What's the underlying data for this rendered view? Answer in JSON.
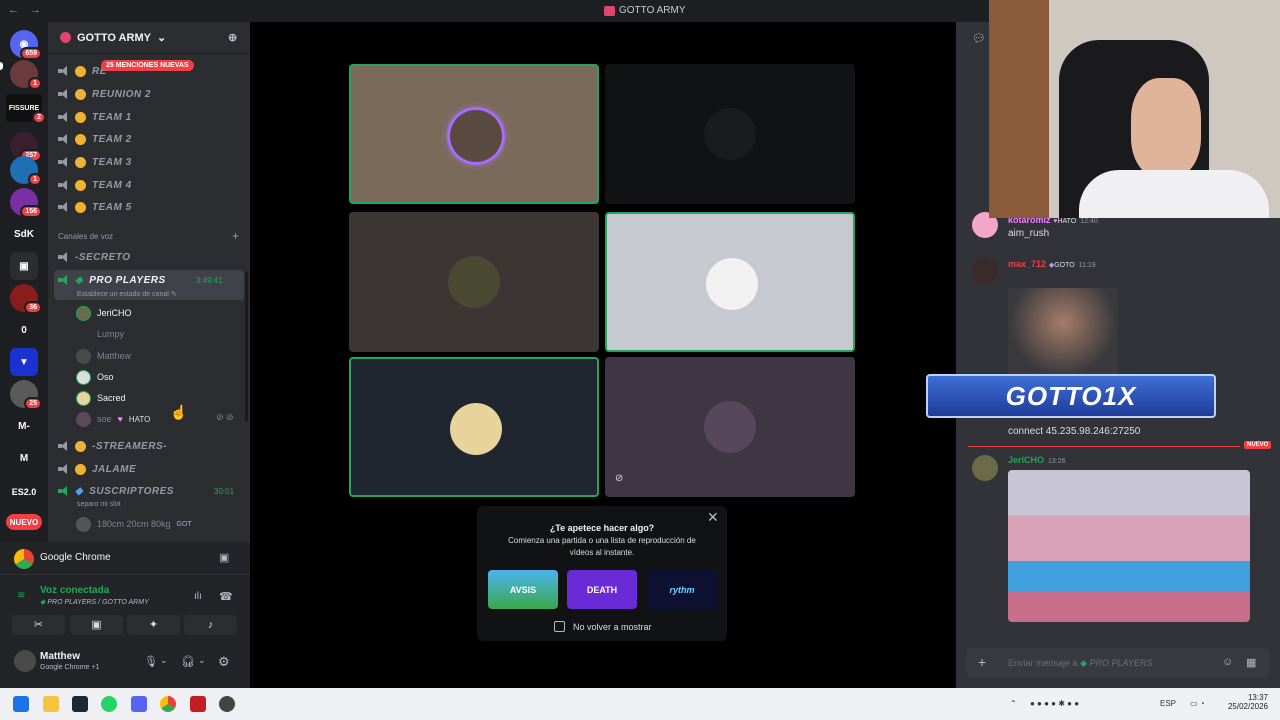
{
  "window": {
    "title": "GOTTO ARMY",
    "nav": "← →"
  },
  "rail": {
    "badges": [
      "659",
      "1",
      "2",
      "257",
      "1",
      "156",
      "36",
      "25"
    ],
    "labels": {
      "fissure": "FISSURE",
      "sdk": "SdK",
      "zero": "0",
      "m_dash": "M-",
      "m": "M",
      "es": "ES2.0",
      "nuevo": "NUEVO"
    }
  },
  "guild": {
    "name": "GOTTO ARMY",
    "mentions": "25 MENCIONES NUEVAS"
  },
  "channels": {
    "top": [
      "REUNION 2",
      "TEAM 1",
      "TEAM 2",
      "TEAM 3",
      "TEAM 4",
      "TEAM 5"
    ],
    "first_partial": "RE",
    "voice_category": "Canales de voz",
    "secreto": "-SECRETO",
    "pro_players": {
      "name": "PRO PLAYERS",
      "time": "3:49:41",
      "status": "Establece un estado de canal"
    },
    "members": [
      "JeriCHO",
      "Lumpy",
      "Matthew",
      "Oso",
      "Sacred",
      "soe"
    ],
    "soe_tag": "HATO",
    "streamers": "-STREAMERS-",
    "jalame": "JALAME",
    "suscriptores": {
      "name": "SUSCRIPTORES",
      "time": "30:01",
      "status": "separo mi slot"
    },
    "sub_member": "180cm 20cm 80kg",
    "sub_tag": "GOT"
  },
  "panel": {
    "app": "Google Chrome",
    "voice_status": "Voz conectada",
    "voice_channel": "PRO PLAYERS / GOTTO ARMY",
    "user_name": "Matthew",
    "user_status": "Google Chrome +1"
  },
  "popup": {
    "question": "¿Te apetece hacer algo?",
    "desc": "Comienza una partida o una lista de reproducción de vídeos al instante.",
    "activities": [
      "AVSIS",
      "DEATH",
      "rythm"
    ],
    "checkbox": "No volver a mostrar"
  },
  "chat": {
    "msg1": {
      "author": "kotaromiz",
      "tag": "HATO",
      "time": "12:40",
      "text": "aim_rush"
    },
    "msg2": {
      "author": "max_712",
      "tag": "GOTO",
      "time": "11:19"
    },
    "banner": "GOTTO1X",
    "connect": "connect 45.235.98.246:27250",
    "new_label": "NUEVO",
    "msg3": {
      "author": "JeriCHO",
      "time": "13:26"
    },
    "input_placeholder": "Enviar mensaje a",
    "input_channel": "PRO PLAYERS"
  },
  "taskbar": {
    "lang": "ESP",
    "time": "13:37",
    "date": "25/02/2026"
  },
  "colors": {
    "accent": "#5865f2",
    "green": "#23a55a",
    "red": "#f23f43",
    "bg": "#313338"
  }
}
